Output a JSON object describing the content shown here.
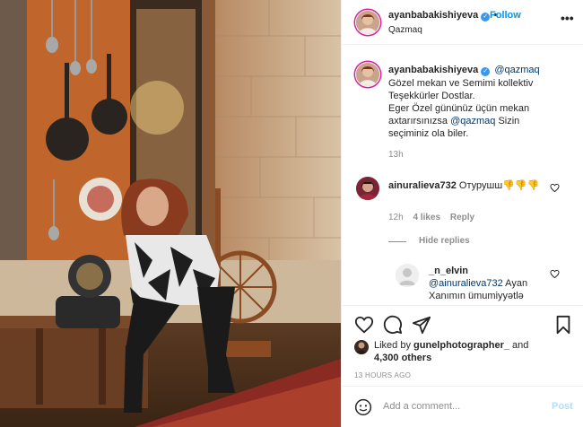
{
  "post": {
    "username": "ayanbabakishiyeva",
    "location": "Qazmaq",
    "follow_label": "Follow",
    "more_label": "•••"
  },
  "caption": {
    "username": "ayanbabakishiyeva",
    "mention": "@qazmaq",
    "line1": "Gözel mekan ve Semimi kollektiv",
    "line2": "Teşekkürler Dostlar.",
    "line3": "Eger Özel gününüz üçün mekan",
    "line4a": "axtarırsınızsa ",
    "line4_mention": "@qazmaq",
    "line4b": " Sizin",
    "line5": "seçiminiz ola biler.",
    "age": "13h"
  },
  "comment": {
    "username": "ainuralieva732",
    "text": "Отурушш👎👎👎",
    "age": "12h",
    "likes": "4 likes",
    "reply": "Reply",
    "hide_replies": "Hide replies"
  },
  "reply_comment": {
    "username": "_n_elvin",
    "mention": "@ainuralieva732",
    "text": " Ayan Xanımın ümumiyyətlə"
  },
  "likes": {
    "prefix": "Liked by ",
    "user": "gunelphotographer_",
    "middle": " and",
    "count": "4,300 others"
  },
  "timestamp": "13 HOURS AGO",
  "add_comment": {
    "placeholder": "Add a comment...",
    "post_label": "Post"
  },
  "colors": {
    "accent": "#0095f6",
    "verified": "#3897f0",
    "muted": "#8e8e8e",
    "mention": "#00376b"
  }
}
